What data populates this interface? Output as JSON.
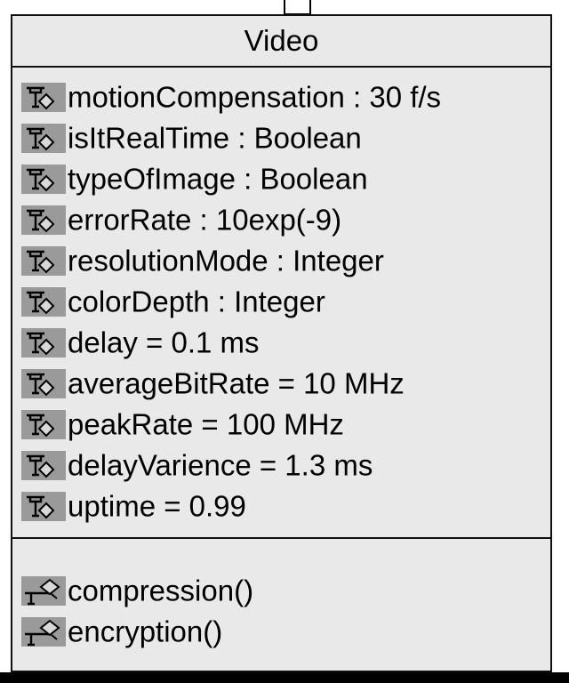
{
  "diagram": {
    "class_name": "Video",
    "attributes": [
      "motionCompensation : 30 f/s",
      "isItRealTime : Boolean",
      "typeOfImage : Boolean",
      "errorRate : 10exp(-9)",
      "resolutionMode : Integer",
      "colorDepth : Integer",
      "delay = 0.1 ms",
      "averageBitRate = 10 MHz",
      "peakRate = 100 MHz",
      "delayVarience = 1.3 ms",
      "uptime = 0.99"
    ],
    "operations": [
      "compression()",
      "encryption()"
    ],
    "colors": {
      "class_fill": "#e9e9e9",
      "icon_fill": "#9a9a9a",
      "border": "#111111"
    }
  }
}
